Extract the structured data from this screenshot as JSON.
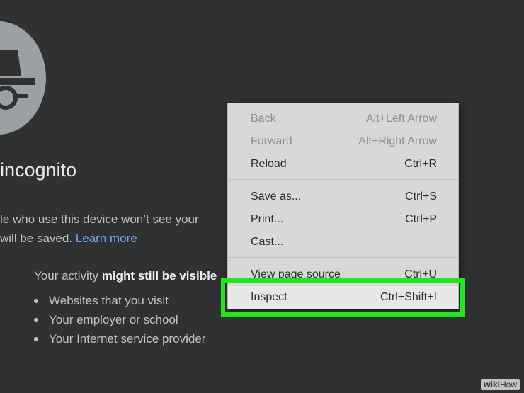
{
  "incognito": {
    "heading": "incognito",
    "intro_line1": "le who use this device won’t see your",
    "intro_line2": "will be saved.",
    "learn_more": "Learn more",
    "activity_prefix": "Your activity",
    "activity_strong": "might still be visible",
    "bullets": [
      "Websites that you visit",
      "Your employer or school",
      "Your Internet service provider"
    ]
  },
  "context_menu": {
    "items": [
      {
        "label": "Back",
        "shortcut": "Alt+Left Arrow",
        "disabled": true
      },
      {
        "label": "Forward",
        "shortcut": "Alt+Right Arrow",
        "disabled": true
      },
      {
        "label": "Reload",
        "shortcut": "Ctrl+R",
        "disabled": false
      },
      {
        "label": "Save as...",
        "shortcut": "Ctrl+S",
        "disabled": false
      },
      {
        "label": "Print...",
        "shortcut": "Ctrl+P",
        "disabled": false
      },
      {
        "label": "Cast...",
        "shortcut": "",
        "disabled": false
      },
      {
        "label": "View page source",
        "shortcut": "Ctrl+U",
        "disabled": false
      },
      {
        "label": "Inspect",
        "shortcut": "Ctrl+Shift+I",
        "disabled": false,
        "highlighted": true
      }
    ]
  },
  "watermark": {
    "wiki": "wiki",
    "how": "How"
  },
  "colors": {
    "background": "#2f3132",
    "link": "#6fa7ff",
    "highlight_border": "#24e61f",
    "menu_bg": "#d8d8d8"
  }
}
